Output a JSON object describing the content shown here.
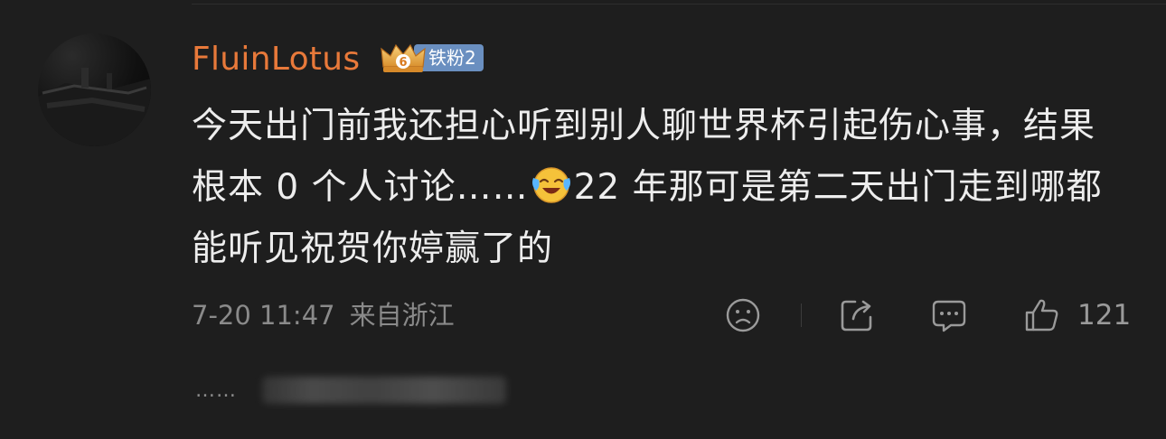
{
  "comment": {
    "username": "FluinLotus",
    "fan_badge": {
      "level_icon": "crown-icon",
      "level_number": "6",
      "label": "铁粉2"
    },
    "text_before_emoji": "今天出门前我还担心听到别人聊世界杯引起伤心事，结果根本 0 个人讨论……",
    "emoji": "laugh-cry-emoji",
    "text_after_emoji": "22 年那可是第二天出门走到哪都能听见祝贺你婷赢了的",
    "timestamp": "7-20 11:47",
    "location": "来自浙江",
    "like_count": "121",
    "reply_preview_prefix": "……"
  },
  "colors": {
    "background": "#1e1e1e",
    "username": "#e8793a",
    "badge": "#6a8fc0",
    "text": "#ededed",
    "meta": "#8a8a8a"
  },
  "icons": [
    "sad-face-icon",
    "share-icon",
    "comment-icon",
    "thumbs-up-icon"
  ]
}
